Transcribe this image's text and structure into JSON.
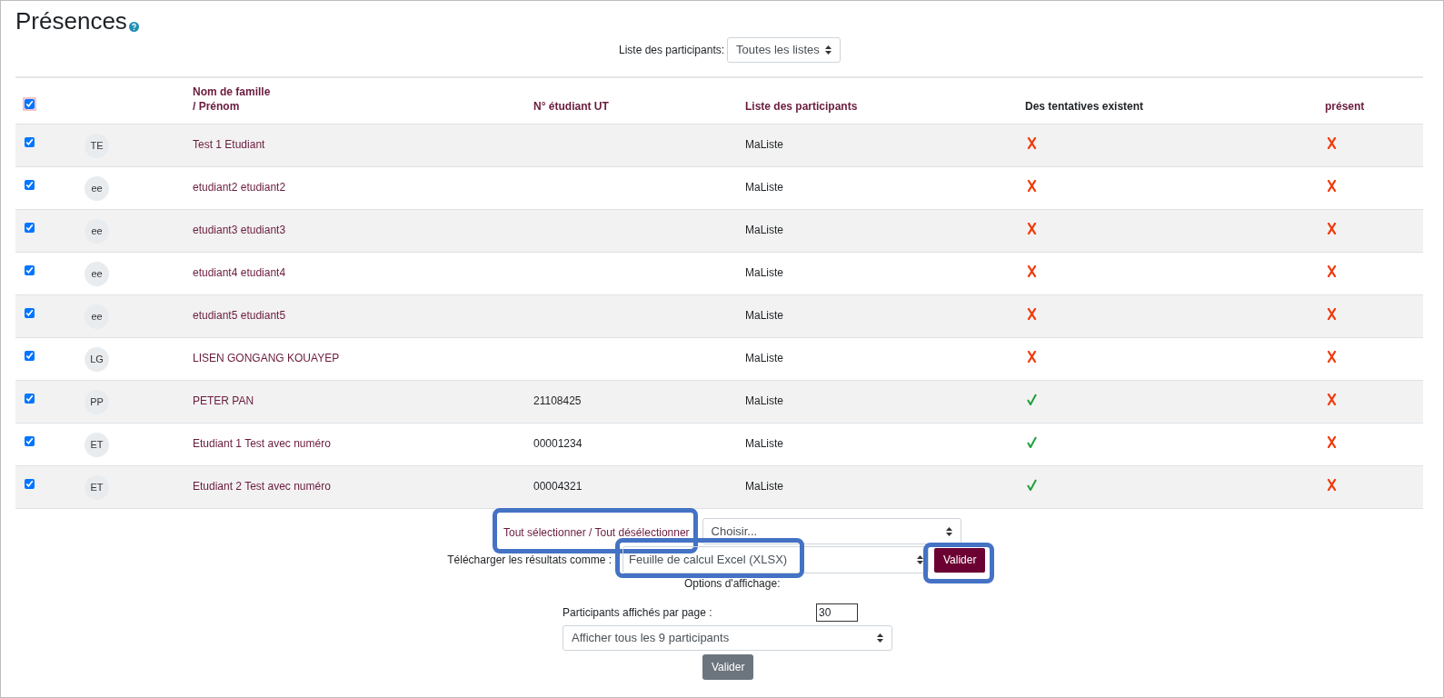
{
  "page": {
    "title": "Présences"
  },
  "filter": {
    "label": "Liste des participants:",
    "value": "Toutes les listes"
  },
  "table": {
    "select_all_checked": true,
    "columns": [
      {
        "kind": "link",
        "lines": [
          "Nom de famille",
          "/ Prénom"
        ]
      },
      {
        "kind": "link",
        "lines": [
          "N° étudiant UT"
        ]
      },
      {
        "kind": "link",
        "lines": [
          "Liste des participants"
        ]
      },
      {
        "kind": "plain",
        "lines": [
          "Des tentatives existent"
        ]
      },
      {
        "kind": "link",
        "lines": [
          "présent"
        ]
      }
    ],
    "rows": [
      {
        "checked": true,
        "initials": "TE",
        "name": "Test 1 Etudiant",
        "list": "MaListe",
        "attempts": false,
        "present": false
      },
      {
        "checked": true,
        "initials": "ee",
        "name": "etudiant2 etudiant2",
        "list": "MaListe",
        "attempts": false,
        "present": false
      },
      {
        "checked": true,
        "initials": "ee",
        "name": "etudiant3 etudiant3",
        "list": "MaListe",
        "attempts": false,
        "present": false
      },
      {
        "checked": true,
        "initials": "ee",
        "name": "etudiant4 etudiant4",
        "list": "MaListe",
        "attempts": false,
        "present": false
      },
      {
        "checked": true,
        "initials": "ee",
        "name": "etudiant5 etudiant5",
        "list": "MaListe",
        "attempts": false,
        "present": false
      },
      {
        "checked": true,
        "initials": "LG",
        "name": "LISEN GONGANG KOUAYEP",
        "list": "MaListe",
        "attempts": false,
        "present": false
      },
      {
        "checked": true,
        "initials": "PP",
        "name": "PETER PAN",
        "number": "21108425",
        "list": "MaListe",
        "attempts": true,
        "present": false
      },
      {
        "checked": true,
        "initials": "ET",
        "name": "Etudiant 1 Test avec numéro",
        "number": "00001234",
        "list": "MaListe",
        "attempts": true,
        "present": false
      },
      {
        "checked": true,
        "initials": "ET",
        "name": "Etudiant 2 Test avec numéro",
        "number": "00004321",
        "list": "MaListe",
        "attempts": true,
        "present": false
      }
    ]
  },
  "select_all_link": {
    "label": "Tout sélectionner / Tout désélectionner",
    "highlighted": true
  },
  "action_select": {
    "value": "Choisir..."
  },
  "download": {
    "label": "Télécharger les résultats comme :",
    "value": "Feuille de calcul Excel (XLSX)",
    "highlighted": true,
    "button": {
      "label": "Valider",
      "highlighted": true
    }
  },
  "display_options": {
    "title": "Options d'affichage:",
    "per_page_label": "Participants affichés par page :",
    "per_page_value": "30",
    "show_all_value": "Afficher tous les 9 participants",
    "button": "Valider"
  }
}
